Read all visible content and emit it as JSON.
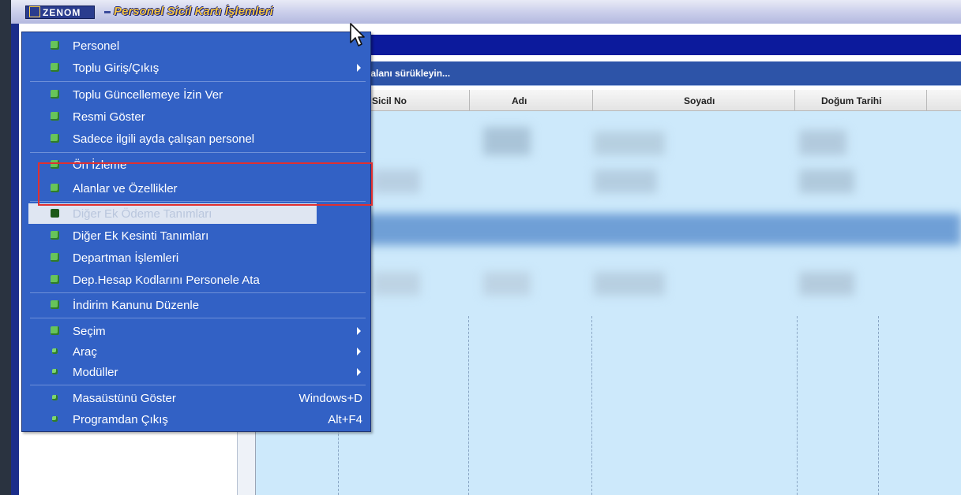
{
  "app": {
    "logo": "ZENOM",
    "title": "Personel Sicil Kartı İşlemleri"
  },
  "group_hint": "z alanı sürükleyin...",
  "columns": [
    "Sicil No",
    "Adı",
    "Soyadı",
    "Doğum Tarihi"
  ],
  "menu": [
    {
      "label": "Personel"
    },
    {
      "label": "Toplu Giriş/Çıkış",
      "submenu": true
    },
    {
      "label": "Toplu Güncellemeye İzin Ver"
    },
    {
      "label": "Resmi Göster"
    },
    {
      "label": "Sadece ilgili ayda çalışan  personel"
    },
    {
      "label": "Ön İzleme"
    },
    {
      "label": "Alanlar ve Özellikler",
      "outlined": true
    },
    {
      "label": "Diğer Ek Ödeme Tanımları",
      "highlighted": true
    },
    {
      "label": "Diğer Ek Kesinti Tanımları"
    },
    {
      "label": "Departman İşlemleri"
    },
    {
      "label": "Dep.Hesap Kodlarını Personele Ata"
    },
    {
      "label": "İndirim Kanunu Düzenle"
    },
    {
      "label": "Seçim",
      "submenu": true
    },
    {
      "label": "Araç",
      "submenu": true
    },
    {
      "label": "Modüller",
      "submenu": true
    },
    {
      "label": "Masaüstünü Göster",
      "shortcut": "Windows+D"
    },
    {
      "label": "Programdan Çıkış",
      "shortcut": "Alt+F4"
    }
  ],
  "colors": {
    "menu_bg": "#3261c5",
    "highlight_box": "#e03030",
    "grid_bg": "#cde9fb"
  }
}
